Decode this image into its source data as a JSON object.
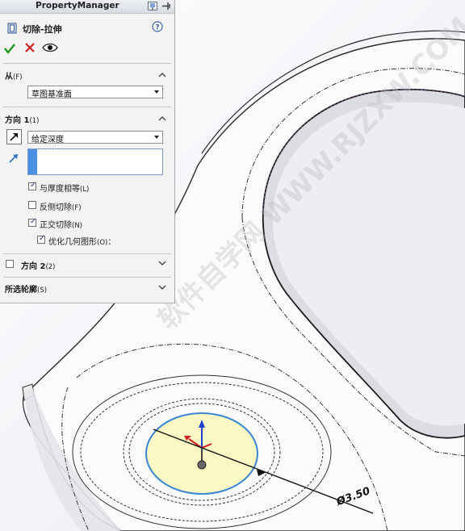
{
  "panel": {
    "title": "PropertyManager",
    "feature_name": "切除-拉伸",
    "from": {
      "label": "从",
      "hotkey": "(F)",
      "value": "草图基准面"
    },
    "direction1": {
      "label": "方向 1",
      "hotkey": "(1)",
      "end_condition": "给定深度",
      "depth_value": "",
      "options": [
        {
          "label": "与厚度相等",
          "hotkey": "(L)",
          "checked": true
        },
        {
          "label": "反侧切除",
          "hotkey": "(F)",
          "checked": false
        },
        {
          "label": "正交切除",
          "hotkey": "(N)",
          "checked": true
        },
        {
          "label": "优化几何图形",
          "hotkey": "(O)",
          "suffix": "：",
          "checked": true
        }
      ]
    },
    "direction2": {
      "label": "方向 2",
      "hotkey": "(2)",
      "checked": false
    },
    "selected_contours": {
      "label": "所选轮廓",
      "hotkey": "(S)"
    }
  },
  "viewport": {
    "dimension_label": "Ø3.50",
    "watermark": "软件自学网 WWW.RJZXW.COM"
  },
  "icons": {
    "ok": "check-icon",
    "cancel": "x-icon",
    "preview": "eye-icon",
    "help": "help-icon",
    "pin": "pushpin-icon",
    "feature": "cut-extrude-icon",
    "reverse_direction": "reverse-direction-icon",
    "depth": "depth-arrow-icon",
    "collapse": "chevron-up-icon",
    "expand": "chevron-down-icon"
  },
  "colors": {
    "panel_bg": "#f3f3f3",
    "accent_blue": "#4a90e2",
    "ok_green": "#1e9a1e",
    "cancel_red": "#d42020",
    "sketch_fill": "#fbf8c4",
    "sketch_circle": "#3a86d4"
  }
}
